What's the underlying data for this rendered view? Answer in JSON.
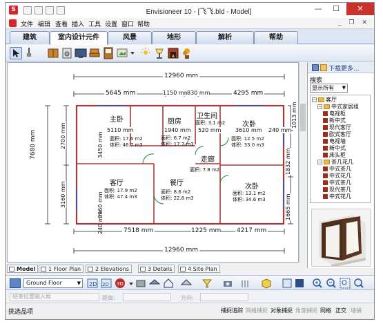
{
  "window": {
    "title": "Envisioneer 10 - [飞飞.bld - Model]",
    "app_icon_letter": "S",
    "controls": {
      "minimize": "—",
      "maximize": "☐",
      "close": "✕"
    }
  },
  "menu": {
    "items": [
      "文件",
      "编辑",
      "查看",
      "插入",
      "工具",
      "设置",
      "窗口",
      "帮助"
    ],
    "mdi_controls": "_ ❐ ✕"
  },
  "tabs": [
    "建筑",
    "室内设计元件",
    "风景",
    "地形",
    "解析",
    "帮助"
  ],
  "active_tab": "室内设计元件",
  "tools_row": [
    "select-arrow-icon",
    "paint-brush-icon",
    "cabinet-icon",
    "appliance-icon",
    "tv-icon",
    "chair-icon",
    "wardrobe-icon",
    "picture-icon",
    "light-icon",
    "lamp-icon",
    "fireplace-icon",
    "plant-icon"
  ],
  "plan": {
    "dims": {
      "top_total": "12960 mm",
      "top_a": "5645 mm",
      "top_b": "1150 mm",
      "top_c": "830 mm",
      "top_d": "4295 mm",
      "row1_a": "5110 mm",
      "row1_b": "1940 mm",
      "row1_c": "520 mm",
      "row1_d": "3610 mm",
      "row1_e": "240 mm",
      "left_total": "7680 mm",
      "left_a": "2700 mm",
      "left_b": "3160 mm",
      "left_c": "240 mm",
      "right_a": "1013 mm",
      "right_b": "1832 mm",
      "right_c": "1665 mm",
      "inner_v1": "3450 mm",
      "inner_v2": "3960 mm",
      "bottom_a": "7518 mm",
      "bottom_b": "1225 mm",
      "bottom_c": "4217 mm",
      "bottom_total": "12960 mm"
    },
    "rooms": [
      {
        "name": "主卧",
        "area_label": "面积:",
        "area": "17.6 m2",
        "vol_label": "体积:",
        "vol": "46.7 m3"
      },
      {
        "name": "厨房",
        "area_label": "面积:",
        "area": "6.7 m2",
        "vol_label": "体积:",
        "vol": "17.7 m3"
      },
      {
        "name": "卫生间",
        "area_label": "面积:",
        "area": "3.1 m2",
        "vol_label": "",
        "vol": ""
      },
      {
        "name": "次卧",
        "area_label": "面积:",
        "area": "12.5 m2",
        "vol_label": "体积:",
        "vol": "33.0 m3"
      },
      {
        "name": "走廊",
        "area_label": "面积:",
        "area": "7.8 m2",
        "vol_label": "",
        "vol": ""
      },
      {
        "name": "客厅",
        "area_label": "面积:",
        "area": "17.9 m2",
        "vol_label": "体积:",
        "vol": "47.4 m3"
      },
      {
        "name": "餐厅",
        "area_label": "面积:",
        "area": "8.6 m2",
        "vol_label": "体积:",
        "vol": "22.8 m3"
      },
      {
        "name": "次卧",
        "area_label": "面积:",
        "area": "13.1 m2",
        "vol_label": "体积:",
        "vol": "34.6 m3"
      }
    ]
  },
  "catalog": {
    "download_label": "下载更多...",
    "search_label": "搜索",
    "filter": "显示所有",
    "tree": [
      {
        "level": 0,
        "kind": "folder",
        "sign": "−",
        "text": "客厅"
      },
      {
        "level": 1,
        "kind": "folder",
        "sign": "−",
        "text": "中式家居组"
      },
      {
        "level": 2,
        "kind": "item",
        "sign": "",
        "text": "电视柜"
      },
      {
        "level": 2,
        "kind": "item",
        "sign": "",
        "text": "新中式"
      },
      {
        "level": 2,
        "kind": "item",
        "sign": "",
        "text": "现代客厅"
      },
      {
        "level": 2,
        "kind": "item",
        "sign": "",
        "text": "欧式客厅"
      },
      {
        "level": 2,
        "kind": "item",
        "sign": "",
        "text": "电视墙"
      },
      {
        "level": 2,
        "kind": "item",
        "sign": "",
        "text": "新中式"
      },
      {
        "level": 2,
        "kind": "item",
        "sign": "",
        "text": "床头柜"
      },
      {
        "level": 1,
        "kind": "folder",
        "sign": "−",
        "text": "茶几花几"
      },
      {
        "level": 2,
        "kind": "item",
        "sign": "",
        "text": "中式茶几"
      },
      {
        "level": 2,
        "kind": "item",
        "sign": "",
        "text": "中式花几"
      },
      {
        "level": 2,
        "kind": "item",
        "sign": "",
        "text": "中式茶几"
      },
      {
        "level": 2,
        "kind": "item",
        "sign": "",
        "text": "现代茶几"
      },
      {
        "level": 2,
        "kind": "item",
        "sign": "",
        "text": "中式花几"
      }
    ]
  },
  "view_tabs": [
    "Model",
    "1 Floor Plan",
    "2 Elevations",
    "3 Details",
    "4 Site Plan"
  ],
  "floor_select": "Ground Floor",
  "props": {
    "field1": "结束位置输入框",
    "label2": "距离:",
    "label3": "方向:"
  },
  "status": {
    "left": "挑选品项",
    "items": [
      {
        "text": "捕捉追踪",
        "on": true
      },
      {
        "text": "网格捕捉",
        "on": false
      },
      {
        "text": "对象捕捉",
        "on": true
      },
      {
        "text": "角度捕捉",
        "on": false
      },
      {
        "text": "网格",
        "on": true
      },
      {
        "text": "正交",
        "on": true
      },
      {
        "text": "墙捕",
        "on": false
      }
    ]
  },
  "colors": {
    "wall": "#a33a36",
    "dim_line": "#222222",
    "door_swing": "#1a8a2a",
    "tab_bg": "#dde6f2",
    "accent_red": "#d6262b"
  }
}
